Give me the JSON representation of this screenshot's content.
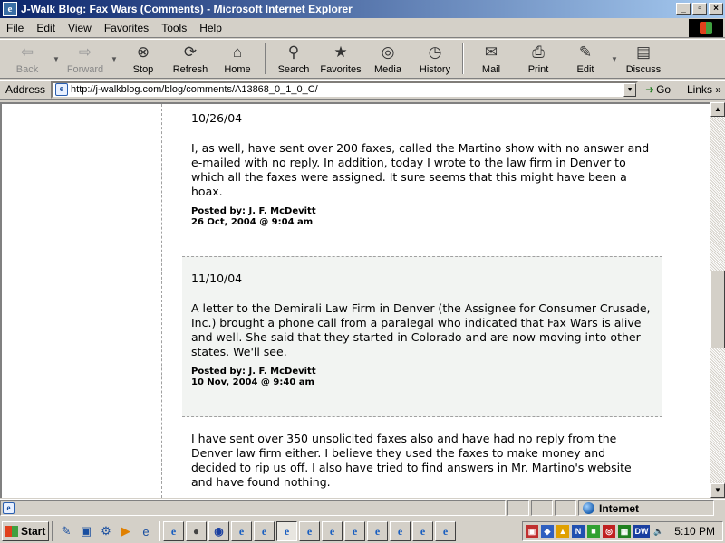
{
  "window": {
    "title": "J-Walk Blog:  Fax Wars (Comments) - Microsoft Internet Explorer",
    "controls": {
      "minimize": "_",
      "maximize": "▫",
      "close": "×"
    }
  },
  "menu": [
    {
      "key": "F",
      "rest": "ile"
    },
    {
      "key": "E",
      "rest": "dit"
    },
    {
      "key": "V",
      "rest": "iew"
    },
    {
      "key": "",
      "pre": "F",
      "key2": "a",
      "rest": "vorites"
    },
    {
      "key": "T",
      "rest": "ools"
    },
    {
      "key": "H",
      "rest": "elp"
    }
  ],
  "menu_labels": [
    "File",
    "Edit",
    "View",
    "Favorites",
    "Tools",
    "Help"
  ],
  "toolbar": {
    "back": "Back",
    "forward": "Forward",
    "stop": "Stop",
    "refresh": "Refresh",
    "home": "Home",
    "search": "Search",
    "favorites": "Favorites",
    "media": "Media",
    "history": "History",
    "mail": "Mail",
    "print": "Print",
    "edit": "Edit",
    "discuss": "Discuss"
  },
  "address": {
    "label": "Address",
    "url": "http://j-walkblog.com/blog/comments/A13868_0_1_0_C/",
    "go": "Go",
    "links": "Links"
  },
  "comments": [
    {
      "date": "10/26/04",
      "body": "I, as well, have sent over 200 faxes, called the Martino show with no answer and e-mailed with no reply. In addition, today I wrote to the law firm in Denver to which all the faxes were assigned. It sure seems that this might have been a hoax.",
      "posted_by": "Posted by: J. F. McDevitt",
      "timestamp": "26 Oct, 2004 @ 9:04 am"
    },
    {
      "date": "11/10/04",
      "body": "A letter to the Demirali Law Firm in Denver (the Assignee for Consumer Crusade, Inc.) brought a phone call from a paralegal who indicated that Fax Wars is alive and well. She said that they started in Colorado and are now moving into other states. We'll see.",
      "posted_by": "Posted by: J. F. McDevitt",
      "timestamp": "10 Nov, 2004 @ 9:40 am"
    },
    {
      "body": "I have sent over 350 unsolicited faxes also and have had no reply from the Denver law firm either. I believe they used the faxes to make money and decided to rip us off. I also have tried to find answers in Mr. Martino's website and have found nothing."
    }
  ],
  "status": {
    "zone": "Internet"
  },
  "taskbar": {
    "start": "Start",
    "clock": "5:10 PM"
  }
}
